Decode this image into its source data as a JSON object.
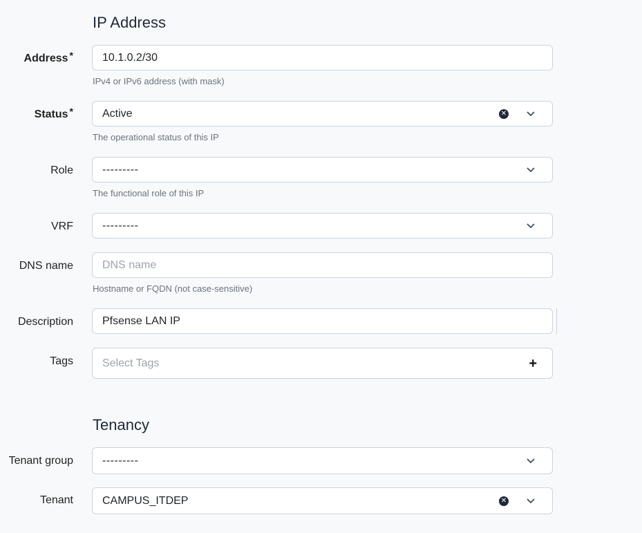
{
  "ip_section": {
    "title": "IP Address",
    "address": {
      "label": "Address",
      "required_mark": "*",
      "value": "10.1.0.2/30",
      "help": "IPv4 or IPv6 address (with mask)"
    },
    "status": {
      "label": "Status",
      "required_mark": "*",
      "value": "Active",
      "help": "The operational status of this IP"
    },
    "role": {
      "label": "Role",
      "value": "---------",
      "help": "The functional role of this IP"
    },
    "vrf": {
      "label": "VRF",
      "value": "---------"
    },
    "dns": {
      "label": "DNS name",
      "placeholder": "DNS name",
      "help": "Hostname or FQDN (not case-sensitive)"
    },
    "description": {
      "label": "Description",
      "value": "Pfsense LAN IP"
    },
    "tags": {
      "label": "Tags",
      "placeholder": "Select Tags"
    }
  },
  "tenancy_section": {
    "title": "Tenancy",
    "tenant_group": {
      "label": "Tenant group",
      "value": "---------"
    },
    "tenant": {
      "label": "Tenant",
      "value": "CAMPUS_ITDEP"
    }
  },
  "icons": {
    "clear": "clear-icon",
    "dropdown": "chevron-down-icon",
    "add": "plus-icon"
  }
}
